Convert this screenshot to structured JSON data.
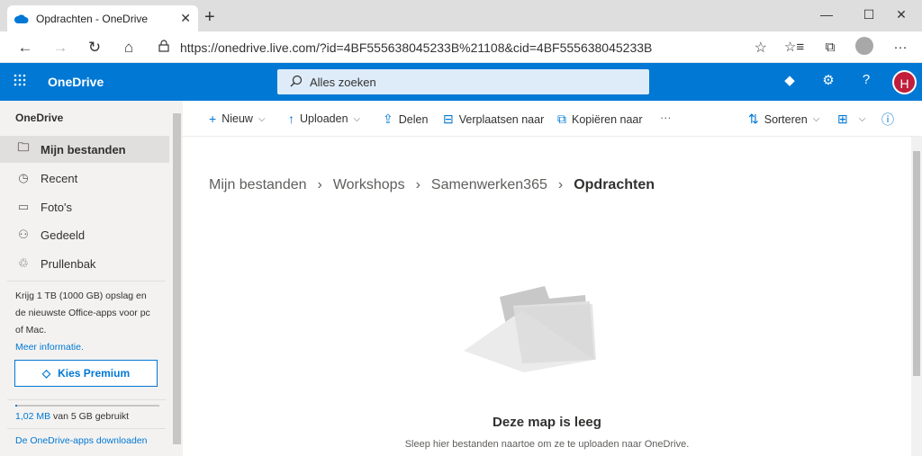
{
  "browser": {
    "tab_title": "Opdrachten - OneDrive",
    "tab_close": "✕",
    "new_tab": "+",
    "url": "https://onedrive.live.com/?id=4BF555638045233B%21108&cid=4BF555638045233B",
    "minimize": "—",
    "maximize": "☐",
    "close": "✕",
    "back": "←",
    "forward": "→",
    "reload": "↻",
    "home": "⌂",
    "lock": "🔒",
    "favorite": "☆",
    "favorites": "☆≡",
    "collections": "⧉",
    "more": "···"
  },
  "suite": {
    "waffle": "⠿",
    "brand": "OneDrive",
    "search_placeholder": "Alles zoeken",
    "search_icon": "⚲",
    "premium_icon": "◆",
    "settings_icon": "⚙",
    "help_icon": "?",
    "avatar_initial": "H"
  },
  "sidebar": {
    "title": "OneDrive",
    "items": [
      {
        "label": "Mijn bestanden",
        "icon": "folder-icon",
        "glyph": "🗀"
      },
      {
        "label": "Recent",
        "icon": "recent-icon",
        "glyph": "◷"
      },
      {
        "label": "Foto's",
        "icon": "photos-icon",
        "glyph": "▭"
      },
      {
        "label": "Gedeeld",
        "icon": "shared-icon",
        "glyph": "⚇"
      },
      {
        "label": "Prullenbak",
        "icon": "recycle-bin-icon",
        "glyph": "♲"
      }
    ],
    "promo_text": "Krijg 1 TB (1000 GB) opslag en de nieuwste Office-apps voor pc of Mac.",
    "promo_link": "Meer informatie.",
    "premium_button": "Kies Premium",
    "premium_icon": "◇",
    "storage_text": "van 5 GB gebruikt",
    "storage_used": "1,02 MB",
    "storage_fraction": 0.0002,
    "download_link": "De OneDrive-apps downloaden"
  },
  "commands": {
    "new": "Nieuw",
    "upload": "Uploaden",
    "share": "Delen",
    "move": "Verplaatsen naar",
    "copy": "Kopiëren naar",
    "more": "···",
    "sort": "Sorteren",
    "view": "⊞",
    "info": "ⓘ",
    "chevron": "⌵"
  },
  "breadcrumb": {
    "items": [
      "Mijn bestanden",
      "Workshops",
      "Samenwerken365"
    ],
    "current": "Opdrachten",
    "sep": "›"
  },
  "empty": {
    "title": "Deze map is leeg",
    "subtitle": "Sleep hier bestanden naartoe om ze te uploaden naar OneDrive."
  },
  "colors": {
    "accent": "#0078d4",
    "avatar": "#c01e3a"
  }
}
